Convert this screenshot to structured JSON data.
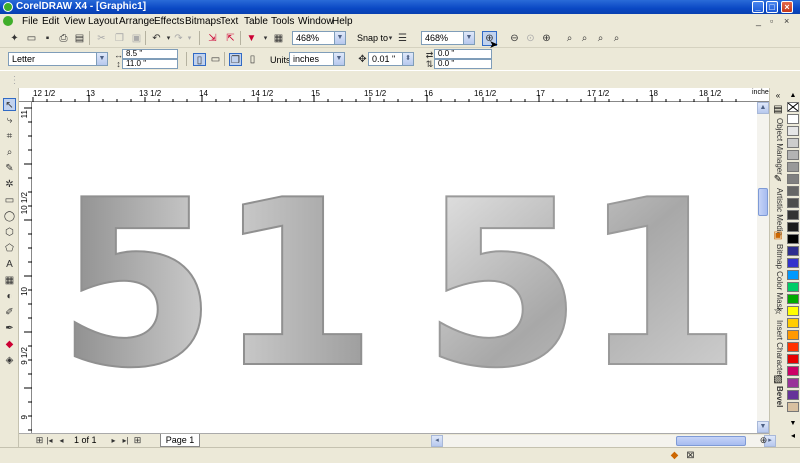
{
  "window": {
    "title": "CorelDRAW X4 - [Graphic1]"
  },
  "menu": [
    "File",
    "Edit",
    "View",
    "Layout",
    "Arrange",
    "Effects",
    "Bitmaps",
    "Text",
    "Table",
    "Tools",
    "Window",
    "Help"
  ],
  "toolbar": {
    "zoom_level": "468%",
    "snap_to": "Snap to",
    "zoom_level_2": "468%"
  },
  "property_bar": {
    "paper_type": "Letter",
    "width": "8.5 \"",
    "height": "11.0 \"",
    "units_label": "Units:",
    "units": "inches",
    "nudge": "0.01 \"",
    "dup_x": "0.0 \"",
    "dup_y": "0.0 \""
  },
  "ruler": {
    "unit": "inches",
    "h_labels": [
      "12 1/2",
      "13",
      "13 1/2",
      "14",
      "14 1/2",
      "15",
      "15 1/2",
      "16",
      "16 1/2",
      "17",
      "17 1/2",
      "18",
      "18 1/2"
    ],
    "v_labels": [
      "11",
      "10 1/2",
      "10",
      "9 1/2",
      "9"
    ]
  },
  "canvas": {
    "artwork_text_1": "51",
    "artwork_text_2": "51"
  },
  "pages": {
    "counter": "1 of 1",
    "tab": "Page 1"
  },
  "dockers": [
    "Object Manager",
    "Artistic Media",
    "Bitmap Color Mask",
    "Insert Character",
    "Bevel"
  ],
  "palette_colors": [
    "#ffffff",
    "#e6e6e6",
    "#cccccc",
    "#b3b3b3",
    "#999999",
    "#808080",
    "#666666",
    "#4d4d4d",
    "#333333",
    "#1a1a1a",
    "#000000",
    "#2e2e8f",
    "#3333cc",
    "#0099ff",
    "#00cc66",
    "#00aa00",
    "#ffff00",
    "#ffcc00",
    "#ff9900",
    "#ff3300",
    "#e60000",
    "#cc0066",
    "#993399",
    "#663399",
    "#d8c0a0"
  ]
}
